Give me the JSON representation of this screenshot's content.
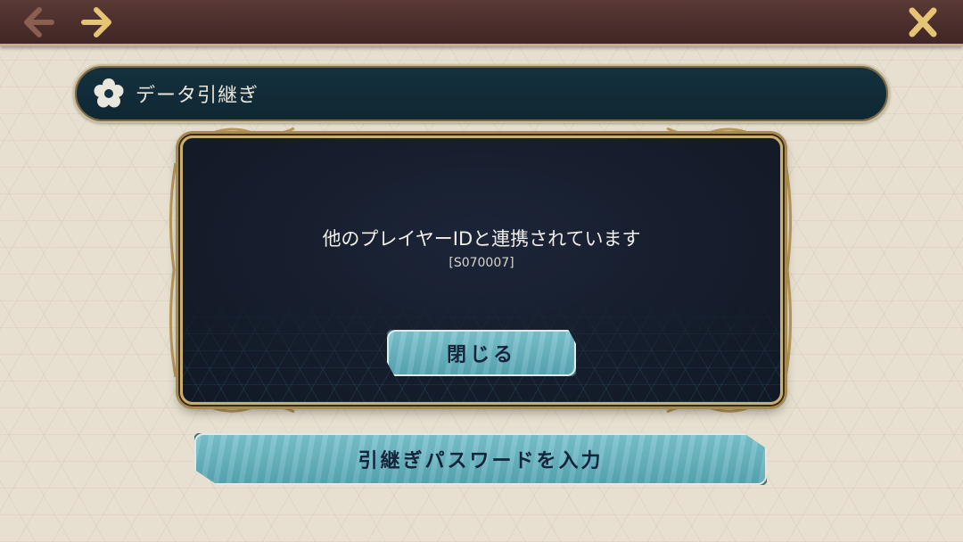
{
  "top_bar": {
    "back_icon": "arrow-left-icon",
    "forward_icon": "arrow-right-icon",
    "close_icon": "close-x-icon"
  },
  "section": {
    "icon": "flower-icon",
    "title": "データ引継ぎ"
  },
  "dialog": {
    "message": "他のプレイヤーIDと連携されています",
    "code": "[S070007]",
    "close_label": "閉じる"
  },
  "actions": {
    "enter_password_label": "引継ぎパスワードを入力"
  },
  "colors": {
    "top_bar": "#4a2e2c",
    "accent_gold": "#c9ad72",
    "dialog_bg": "#151c2a",
    "button_teal": "#6bb6c1",
    "page_bg": "#e7e0d1"
  }
}
